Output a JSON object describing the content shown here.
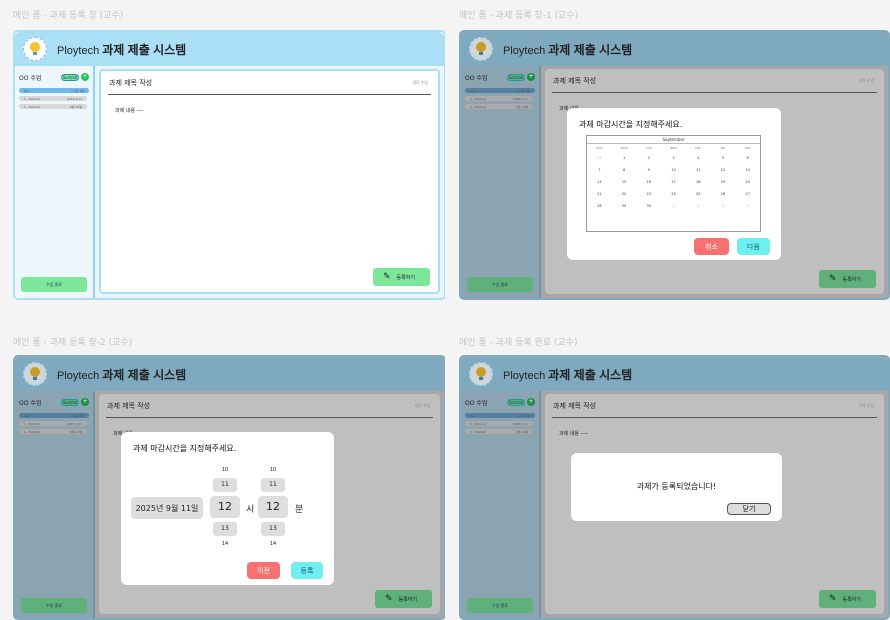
{
  "frames": [
    {
      "label": "메인 폼 - 과제 등록 창 (교수)"
    },
    {
      "label": "메인 폼 - 과제 등록 창-1 (교수)"
    },
    {
      "label": "메인 폼 - 과제 등록 창-2 (교수)"
    },
    {
      "label": "메인 폼 - 과제 등록 완료 (교수)"
    }
  ],
  "app": {
    "brand": "Ploytech",
    "title": "과제 제출 시스템"
  },
  "sidebar": {
    "course_title": "OO 수업",
    "pill_label": "Sort/all",
    "plus": "+",
    "rows": [
      {
        "name": "OO",
        "meta": "1시간 1분"
      },
      {
        "name": "1 - Tutorial",
        "meta": "2025.9.11"
      },
      {
        "name": "1 - Tutorial",
        "meta": "9월 12일"
      }
    ],
    "settings_button": "수업 종료"
  },
  "main": {
    "title_placeholder": "과제 제목 작성",
    "course_tag": "OO 수업",
    "body_placeholder": "과제 내용 ----",
    "register_button": "등록하기"
  },
  "calendar_dialog": {
    "prompt": "과제 마감시간을 지정해주세요.",
    "month": "September",
    "weekdays": [
      "SUN",
      "MON",
      "TUE",
      "WED",
      "THU",
      "FRI",
      "SAT"
    ],
    "weeks": [
      [
        "31",
        "1",
        "2",
        "3",
        "4",
        "5",
        "6"
      ],
      [
        "7",
        "8",
        "9",
        "10",
        "11",
        "12",
        "13"
      ],
      [
        "14",
        "15",
        "16",
        "17",
        "18",
        "19",
        "20"
      ],
      [
        "21",
        "22",
        "23",
        "24",
        "25",
        "26",
        "27"
      ],
      [
        "28",
        "29",
        "30",
        "1",
        "2",
        "3",
        "4"
      ]
    ],
    "cancel_button": "취소",
    "next_button": "다음"
  },
  "time_dialog": {
    "prompt": "과제 마감시간을 지정해주세요.",
    "date": "2025년 9월 11일",
    "hour_wheel": [
      "10",
      "11",
      "12",
      "13",
      "14"
    ],
    "minute_wheel": [
      "10",
      "11",
      "12",
      "13",
      "14"
    ],
    "hour_unit": "시",
    "minute_unit": "분",
    "prev_button": "이전",
    "submit_button": "등록"
  },
  "done_dialog": {
    "message": "과제가 등록되었습니다!",
    "close_button": "닫기"
  },
  "colors": {
    "header_active": "#abdff6",
    "header_dim": "#7fa9bf",
    "main_dim": "#bfbfbf",
    "sidebar_active": "#eef7fc",
    "accent_green": "#7ce79b",
    "accent_red": "#f87171",
    "accent_cyan": "#6ef0f0"
  }
}
